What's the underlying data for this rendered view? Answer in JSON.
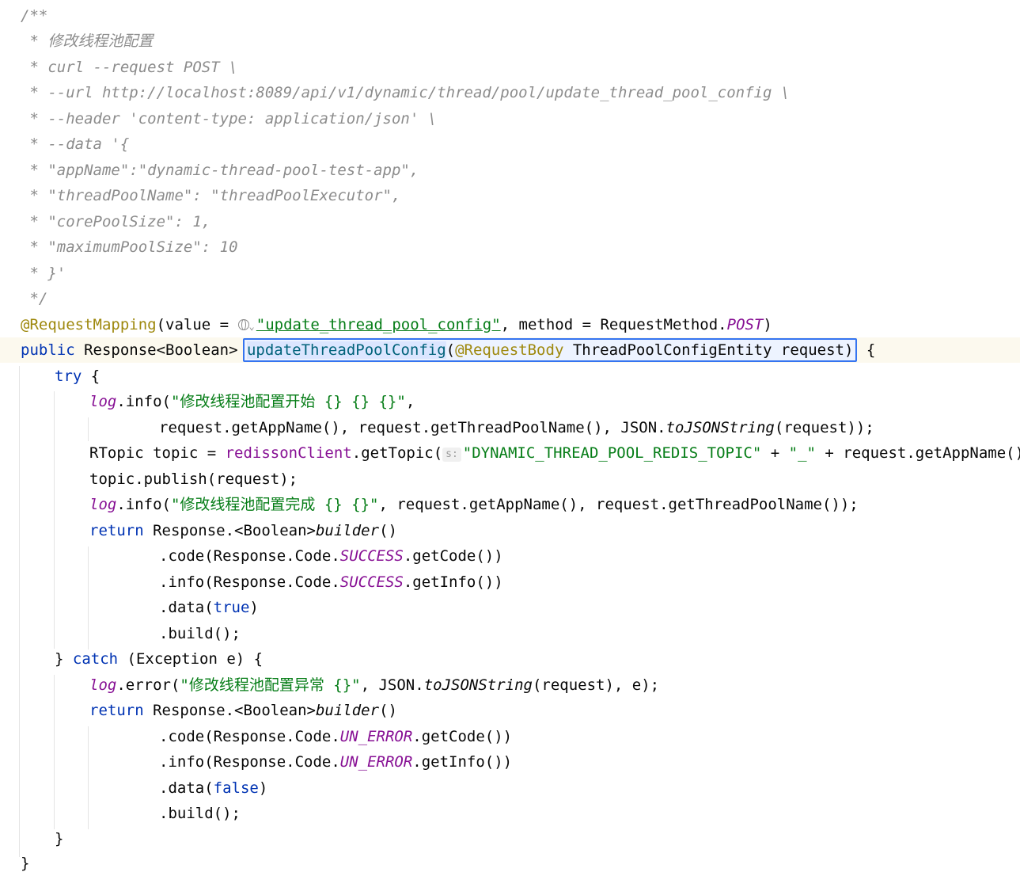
{
  "doc_comment": {
    "open": "/**",
    "lines": [
      " * 修改线程池配置",
      " * curl --request POST \\",
      " * --url http://localhost:8089/api/v1/dynamic/thread/pool/update_thread_pool_config \\",
      " * --header 'content-type: application/json' \\",
      " * --data '{",
      " * \"appName\":\"dynamic-thread-pool-test-app\",",
      " * \"threadPoolName\": \"threadPoolExecutor\",",
      " * \"corePoolSize\": 1,",
      " * \"maximumPoolSize\": 10",
      " * }'"
    ],
    "close": " */"
  },
  "annotation_line": {
    "annotation": "@RequestMapping",
    "open": "(value = ",
    "value_string": "\"update_thread_pool_config\"",
    "method_part": ", method = RequestMethod.",
    "method_value": "POST",
    "close": ")"
  },
  "signature": {
    "keyword": "public",
    "return_type": " Response<Boolean> ",
    "method_name": "updateThreadPoolConfig",
    "paren_open": "(",
    "param_annotation": "@RequestBody",
    "param": " ThreadPoolConfigEntity request)",
    "brace": " {"
  },
  "body": {
    "try_kw": "try",
    "brace_open": " {",
    "log1_field": "log",
    "log1_call": ".info(",
    "log1_str": "\"修改线程池配置开始 {} {} {}\"",
    "log1_end": ",",
    "log1_cont_a": "request.getAppName(), request.getThreadPoolName(), JSON.",
    "log1_cont_fn": "toJSONString",
    "log1_cont_b": "(request));",
    "topic_a": "RTopic topic = ",
    "topic_field": "redissonClient",
    "topic_b": ".getTopic(",
    "topic_hint": "s:",
    "topic_str1": "\"DYNAMIC_THREAD_POOL_REDIS_TOPIC\"",
    "topic_c": " + ",
    "topic_str2": "\"_\"",
    "topic_d": " + request.getAppName());",
    "publish": "topic.publish(request);",
    "log2_field": "log",
    "log2_call": ".info(",
    "log2_str": "\"修改线程池配置完成 {} {}\"",
    "log2_rest": ", request.getAppName(), request.getThreadPoolName());",
    "return_kw": "return",
    "builder_a": " Response.<Boolean>",
    "builder_fn": "builder",
    "builder_b": "()",
    "code_a": ".code(Response.Code.",
    "code_const": "SUCCESS",
    "code_b": ".getCode())",
    "info_a": ".info(Response.Code.",
    "info_const": "SUCCESS",
    "info_b": ".getInfo())",
    "data_a": ".data(",
    "data_val": "true",
    "data_b": ")",
    "build": ".build();",
    "catch_a": "} ",
    "catch_kw": "catch",
    "catch_b": " (Exception e) {",
    "err_field": "log",
    "err_call": ".error(",
    "err_str": "\"修改线程池配置异常 {}\"",
    "err_a": ", JSON.",
    "err_fn": "toJSONString",
    "err_b": "(request), e);",
    "return2_kw": "return",
    "builder2_a": " Response.<Boolean>",
    "builder2_fn": "builder",
    "builder2_b": "()",
    "code2_a": ".code(Response.Code.",
    "code2_const": "UN_ERROR",
    "code2_b": ".getCode())",
    "info2_a": ".info(Response.Code.",
    "info2_const": "UN_ERROR",
    "info2_b": ".getInfo())",
    "data2_a": ".data(",
    "data2_val": "false",
    "data2_b": ")",
    "build2": ".build();",
    "try_close": "}",
    "method_close": "}"
  }
}
